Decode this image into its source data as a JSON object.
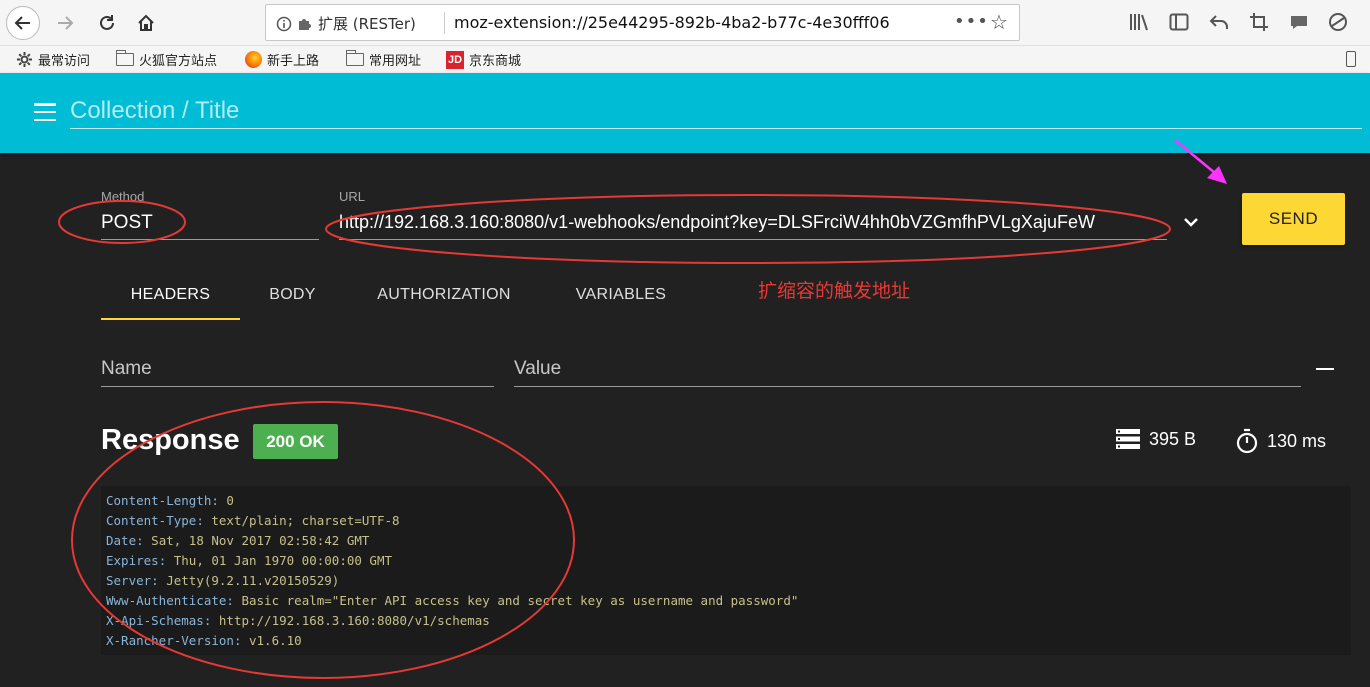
{
  "browser": {
    "identity_label": "扩展 (RESTer)",
    "url": "moz-extension://25e44295-892b-4ba2-b77c-4e30fff06",
    "more_label": "•••"
  },
  "bookmarks": [
    {
      "label": "最常访问",
      "icon": "gear-icon"
    },
    {
      "label": "火狐官方站点",
      "icon": "folder-icon"
    },
    {
      "label": "新手上路",
      "icon": "firefox-icon"
    },
    {
      "label": "常用网址",
      "icon": "folder-icon"
    },
    {
      "label": "京东商城",
      "icon": "jd-icon"
    }
  ],
  "jd_logo": "JD",
  "header": {
    "title_placeholder": "Collection / Title"
  },
  "request": {
    "method_label": "Method",
    "method_value": "POST",
    "url_label": "URL",
    "url_value": "http://192.168.3.160:8080/v1-webhooks/endpoint?key=DLSFrciW4hh0bVZGmfhPVLgXajuFeW",
    "send_label": "SEND"
  },
  "tabs": [
    {
      "label": "HEADERS",
      "active": true
    },
    {
      "label": "BODY",
      "active": false
    },
    {
      "label": "AUTHORIZATION",
      "active": false
    },
    {
      "label": "VARIABLES",
      "active": false
    }
  ],
  "annotation_text": "扩缩容的触发地址",
  "headers_row": {
    "name_placeholder": "Name",
    "value_placeholder": "Value"
  },
  "response": {
    "title": "Response",
    "status": "200 OK",
    "size": "395 B",
    "time": "130 ms",
    "headers": [
      {
        "key": "Content-Length",
        "value": "0"
      },
      {
        "key": "Content-Type",
        "value": "text/plain; charset=UTF-8"
      },
      {
        "key": "Date",
        "value": "Sat, 18 Nov 2017 02:58:42 GMT"
      },
      {
        "key": "Expires",
        "value": "Thu, 01 Jan 1970 00:00:00 GMT"
      },
      {
        "key": "Server",
        "value": "Jetty(9.2.11.v20150529)"
      },
      {
        "key": "Www-Authenticate",
        "value": "Basic realm=\"Enter API access key and secret key as username and password\""
      },
      {
        "key": "X-Api-Schemas",
        "value": "http://192.168.3.160:8080/v1/schemas"
      },
      {
        "key": "X-Rancher-Version",
        "value": "v1.6.10"
      }
    ]
  },
  "colors": {
    "header_bg": "#00bcd4",
    "send_bg": "#fdd835",
    "status_bg": "#4caf50",
    "annotation_red": "#e53935",
    "annotation_magenta": "#ff33ff"
  }
}
